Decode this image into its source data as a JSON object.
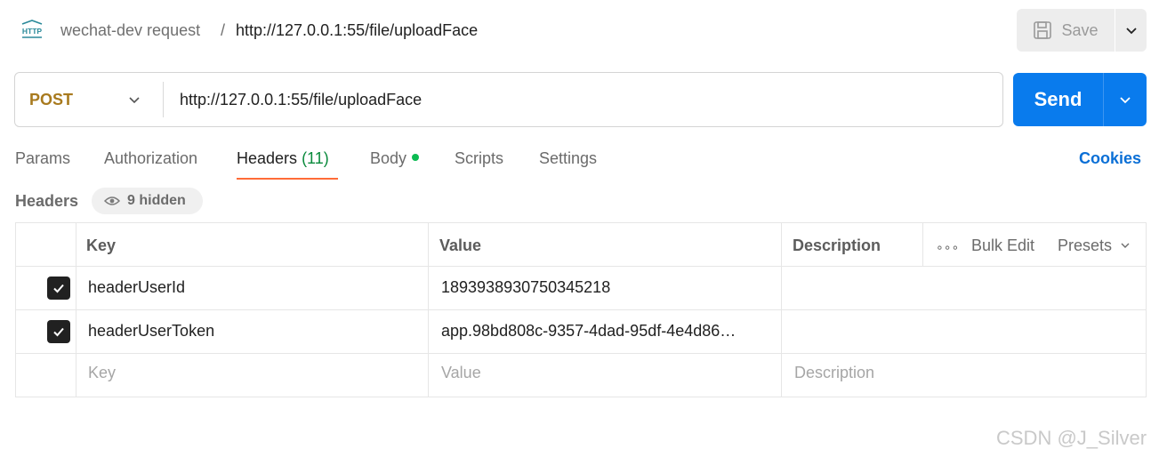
{
  "header": {
    "icon": "http-icon",
    "collection": "wechat-dev request",
    "separator": "/",
    "request_name": "http://127.0.0.1:55/file/uploadFace",
    "save_label": "Save"
  },
  "request": {
    "method": "POST",
    "method_color": "#a87a1e",
    "url": "http://127.0.0.1:55/file/uploadFace",
    "send_label": "Send",
    "send_color": "#097bed"
  },
  "tabs": [
    {
      "label": "Params"
    },
    {
      "label": "Authorization"
    },
    {
      "label": "Headers",
      "count": "(11)",
      "active": true
    },
    {
      "label": "Body",
      "has_dot": true
    },
    {
      "label": "Scripts"
    },
    {
      "label": "Settings"
    }
  ],
  "cookies_label": "Cookies",
  "headers_section": {
    "title": "Headers",
    "hidden_label": "9 hidden"
  },
  "table": {
    "columns": {
      "key": "Key",
      "value": "Value",
      "description": "Description"
    },
    "tools": {
      "more": "∘∘∘",
      "bulk_edit": "Bulk Edit",
      "presets": "Presets"
    },
    "rows": [
      {
        "checked": true,
        "key": "headerUserId",
        "value": "1893938930750345218",
        "description": ""
      },
      {
        "checked": true,
        "key": "headerUserToken",
        "value": "app.98bd808c-9357-4dad-95df-4e4d86…",
        "description": ""
      }
    ],
    "placeholders": {
      "key": "Key",
      "value": "Value",
      "description": "Description"
    }
  },
  "watermark": "CSDN @J_Silver"
}
